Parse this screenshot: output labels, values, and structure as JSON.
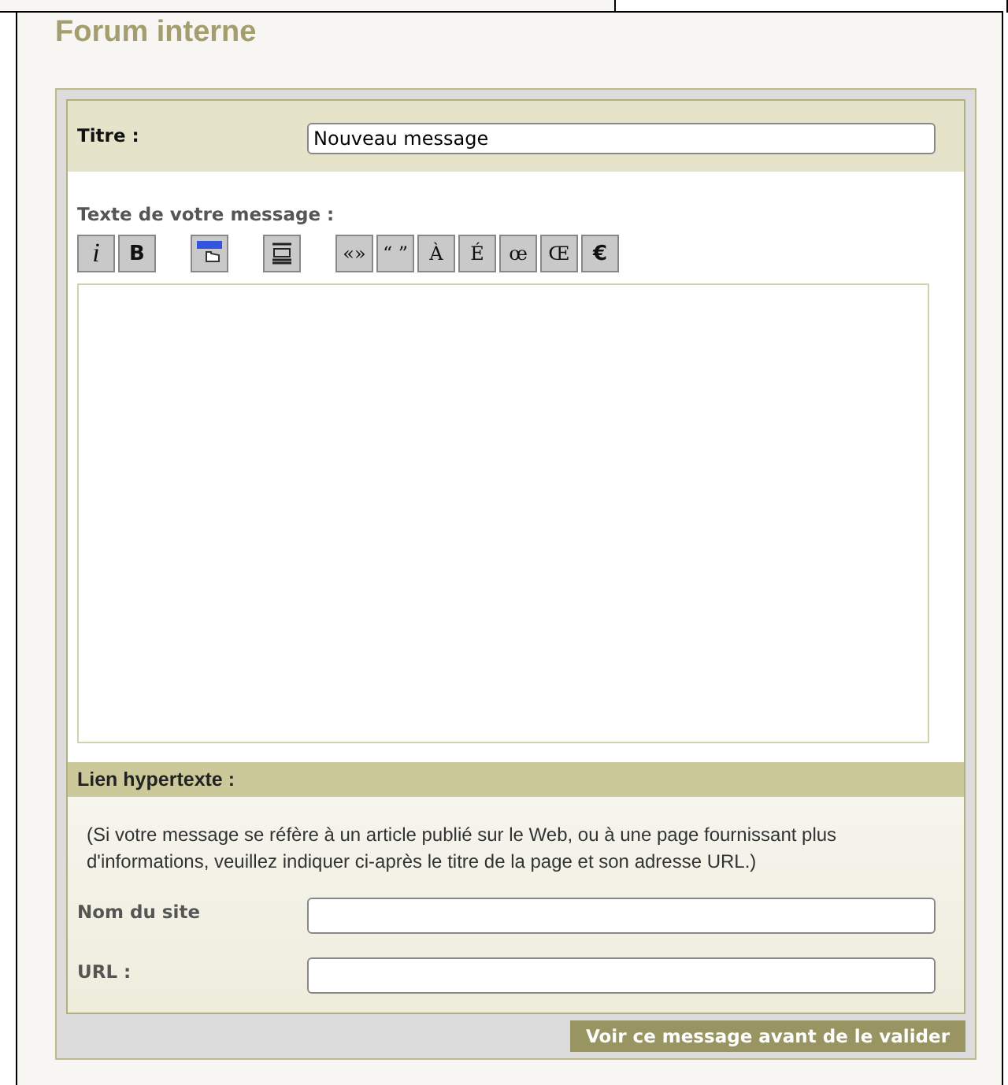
{
  "page": {
    "title": "Forum interne"
  },
  "form": {
    "title_field": {
      "label": "Titre :",
      "value": "Nouveau message"
    },
    "message": {
      "label": "Texte de votre message :"
    },
    "toolbar": [
      {
        "kind": "italic",
        "label": "i"
      },
      {
        "kind": "bold",
        "label": "B"
      },
      {
        "kind": "gap"
      },
      {
        "kind": "link-icon"
      },
      {
        "kind": "gap"
      },
      {
        "kind": "paragraph-icon"
      },
      {
        "kind": "gap"
      },
      {
        "kind": "char",
        "label": "«»"
      },
      {
        "kind": "char",
        "label": "“ ”"
      },
      {
        "kind": "char",
        "label": "À"
      },
      {
        "kind": "char",
        "label": "É"
      },
      {
        "kind": "char",
        "label": "œ"
      },
      {
        "kind": "char",
        "label": "Œ"
      },
      {
        "kind": "euro",
        "label": "€"
      }
    ],
    "link_section": {
      "heading": "Lien hypertexte :",
      "note": "(Si votre message se réfère à un article publié sur le Web, ou à une page fournissant plus d'informations, veuillez indiquer ci-après le titre de la page et son adresse URL.)",
      "fields": [
        {
          "label": "Nom du site"
        },
        {
          "label": "URL :"
        }
      ]
    },
    "submit": "Voir ce message avant de le valider"
  }
}
